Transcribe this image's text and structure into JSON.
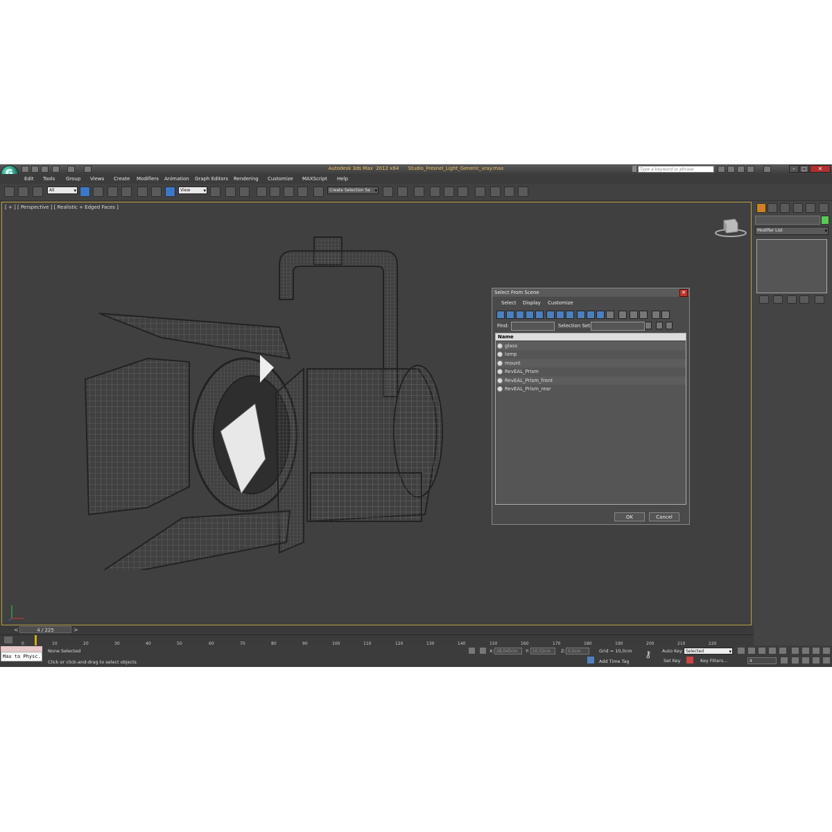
{
  "window": {
    "title": "Autodesk 3ds Max  2012 x64      Studio_Fresnel_Light_Generic_vray.max",
    "search_placeholder": "Type a keyword or phrase"
  },
  "menu": [
    "Edit",
    "Tools",
    "Group",
    "Views",
    "Create",
    "Modifiers",
    "Animation",
    "Graph Editors",
    "Rendering",
    "Customize",
    "MAXScript",
    "Help"
  ],
  "toolbar": {
    "filter_value": "All",
    "reference_coord": "View",
    "selection_set": "Create Selection Se"
  },
  "viewport": {
    "label": "[ + ] [ Perspective ] [ Realistic + Edged Faces ]"
  },
  "command_panel": {
    "modifier_list": "Modifier List"
  },
  "dialog": {
    "title": "Select From Scene",
    "menu": [
      "Select",
      "Display",
      "Customize"
    ],
    "find_label": "Find:",
    "selection_set_label": "Selection Set:",
    "column_header": "Name",
    "objects": [
      "glass",
      "lamp",
      "mount",
      "RevEAL_Prism",
      "RevEAL_Prism_front",
      "RevEAL_Prism_rear"
    ],
    "ok": "OK",
    "cancel": "Cancel"
  },
  "timeline": {
    "frame": "4 / 225",
    "ticks": [
      "0",
      "10",
      "20",
      "30",
      "40",
      "50",
      "60",
      "70",
      "80",
      "90",
      "100",
      "110",
      "120",
      "130",
      "140",
      "150",
      "160",
      "170",
      "180",
      "190",
      "200",
      "210",
      "220"
    ]
  },
  "status": {
    "maxscript": "Max to Physc.",
    "selection": "None Selected",
    "prompt": "Click or click-and-drag to select objects",
    "x_label": "X:",
    "x_value": "28,045cm",
    "y_label": "Y:",
    "y_value": "10,52cm",
    "z_label": "Z:",
    "z_value": "0,0cm",
    "grid": "Grid = 10,0cm",
    "auto_key": "Auto Key",
    "key_mode": "Selected",
    "set_key": "Set Key",
    "key_filters": "Key Filters...",
    "add_time_tag": "Add Time Tag",
    "current_frame": "4"
  }
}
